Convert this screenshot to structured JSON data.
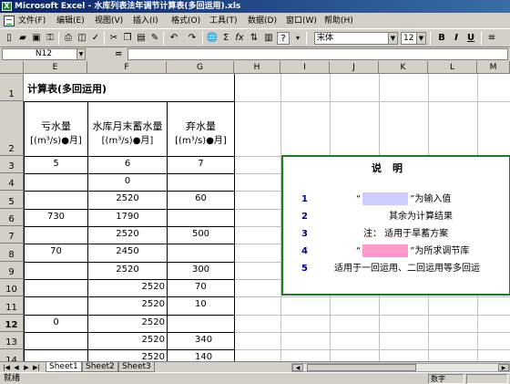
{
  "window": {
    "title": "Microsoft Excel - 水库列表法年调节计算表(多回运用).xls",
    "app_icon": "excel-icon"
  },
  "menu": [
    "文件(F)",
    "编辑(E)",
    "视图(V)",
    "插入(I)",
    "格式(O)",
    "工具(T)",
    "数据(D)",
    "窗口(W)",
    "帮助(H)"
  ],
  "toolbar": {
    "font_name": "宋体",
    "font_size": "12",
    "bold": "B",
    "italic": "I",
    "underline": "U",
    "autosum": "Σ",
    "function": "fx",
    "help": "?",
    "zoom_icon": "zoom-icon"
  },
  "formula_bar": {
    "name_box": "N12",
    "equals": "=",
    "content": ""
  },
  "columns": [
    "E",
    "F",
    "G",
    "H",
    "I",
    "J",
    "K",
    "L",
    "M"
  ],
  "rows": [
    "1",
    "2",
    "3",
    "4",
    "5",
    "6",
    "7",
    "8",
    "9",
    "10",
    "11",
    "12",
    "13",
    "14"
  ],
  "active_row": "12",
  "sheet": {
    "title": "计算表(多回运用)",
    "headers": {
      "e_line1": "亏水量",
      "e_line2": "[(m³/s)●月]",
      "f_line1": "水库月末蓄水量",
      "f_line2": "[(m³/s)●月]",
      "g_line1": "弃水量",
      "g_line2": "[(m³/s)●月]"
    },
    "row3": {
      "e": "5",
      "f": "6",
      "g": "7"
    },
    "data": {
      "F4": "0",
      "F5": "2520",
      "G5": "60",
      "E6": "730",
      "F6": "1790",
      "F7": "2520",
      "G7": "500",
      "E8": "70",
      "F8": "2450",
      "F9": "2520",
      "G9": "300",
      "F10": "2520",
      "G10": "70",
      "F11": "2520",
      "G11": "10",
      "E12": "0",
      "F12": "2520",
      "F13": "2520",
      "G13": "340",
      "F14": "2520",
      "G14": "140"
    }
  },
  "description": {
    "title": "说明",
    "items": [
      {
        "num": "1",
        "pre": "“",
        "post": "”为输入值",
        "swatch": "#ccccff"
      },
      {
        "num": "2",
        "text": "其余为计算结果"
      },
      {
        "num": "3",
        "text": "注：  适用于旱蓄方案"
      },
      {
        "num": "4",
        "pre": "“",
        "post": "”为所求调节库",
        "swatch": "#ff99cc"
      },
      {
        "num": "5",
        "text": "适用于一回运用、二回运用等多回运"
      }
    ],
    "border_color": "#1b7d1b"
  },
  "tabs": {
    "nav": [
      "|◀",
      "◀",
      "▶",
      "▶|"
    ],
    "sheets": [
      "Sheet1",
      "Sheet2",
      "Sheet3"
    ],
    "active": "Sheet1"
  },
  "status": {
    "text": "就绪",
    "panel": "数字"
  }
}
